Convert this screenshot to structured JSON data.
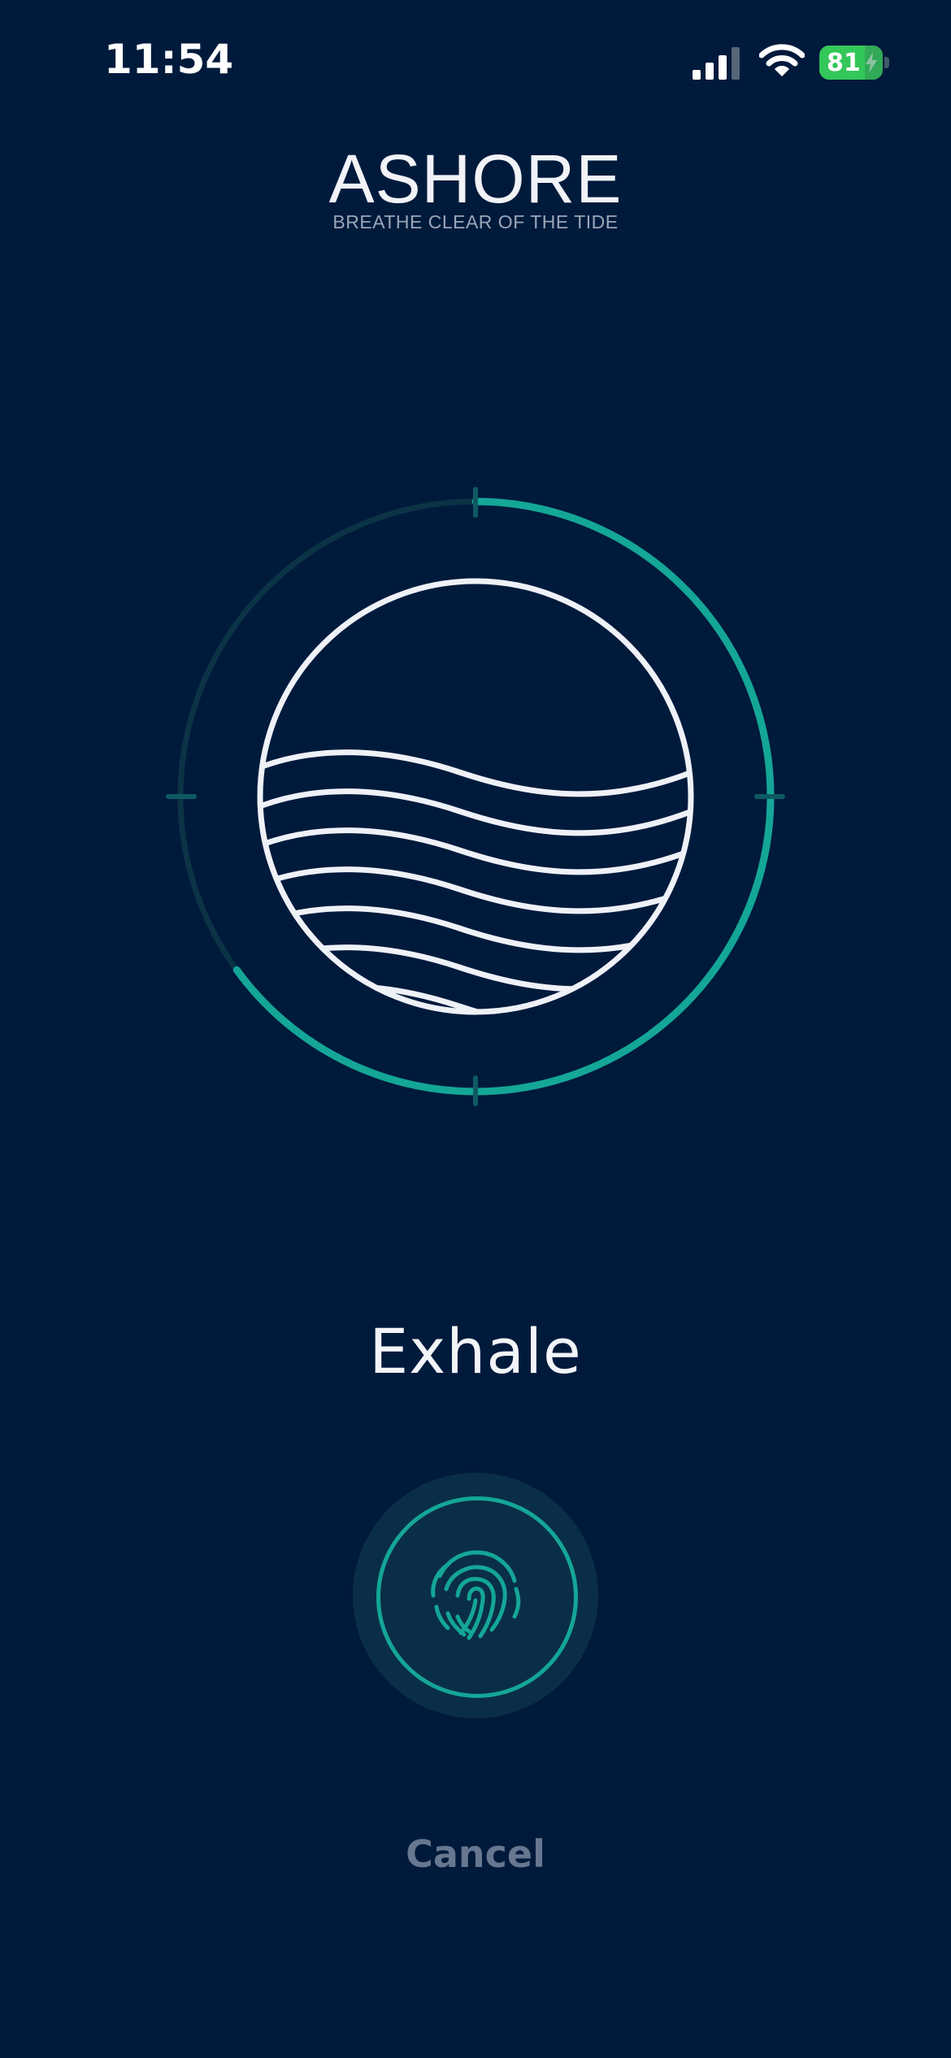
{
  "status_bar": {
    "time": "11:54",
    "battery_percent": "81",
    "battery_charging": true,
    "battery_color": "#34C759"
  },
  "header": {
    "title": "ASHORE",
    "tagline": "BREATHE CLEAR OF THE TIDE"
  },
  "breath": {
    "phase": "Exhale",
    "cycle_progress": 0.65,
    "progress_color": "#14A697",
    "track_color": "#0B3346"
  },
  "controls": {
    "fingerprint_icon": "fingerprint-icon",
    "cancel_label": "Cancel"
  },
  "colors": {
    "background": "#001A3C",
    "accent": "#14A697",
    "text_primary": "#F2F4F8",
    "text_muted": "#67778F"
  }
}
